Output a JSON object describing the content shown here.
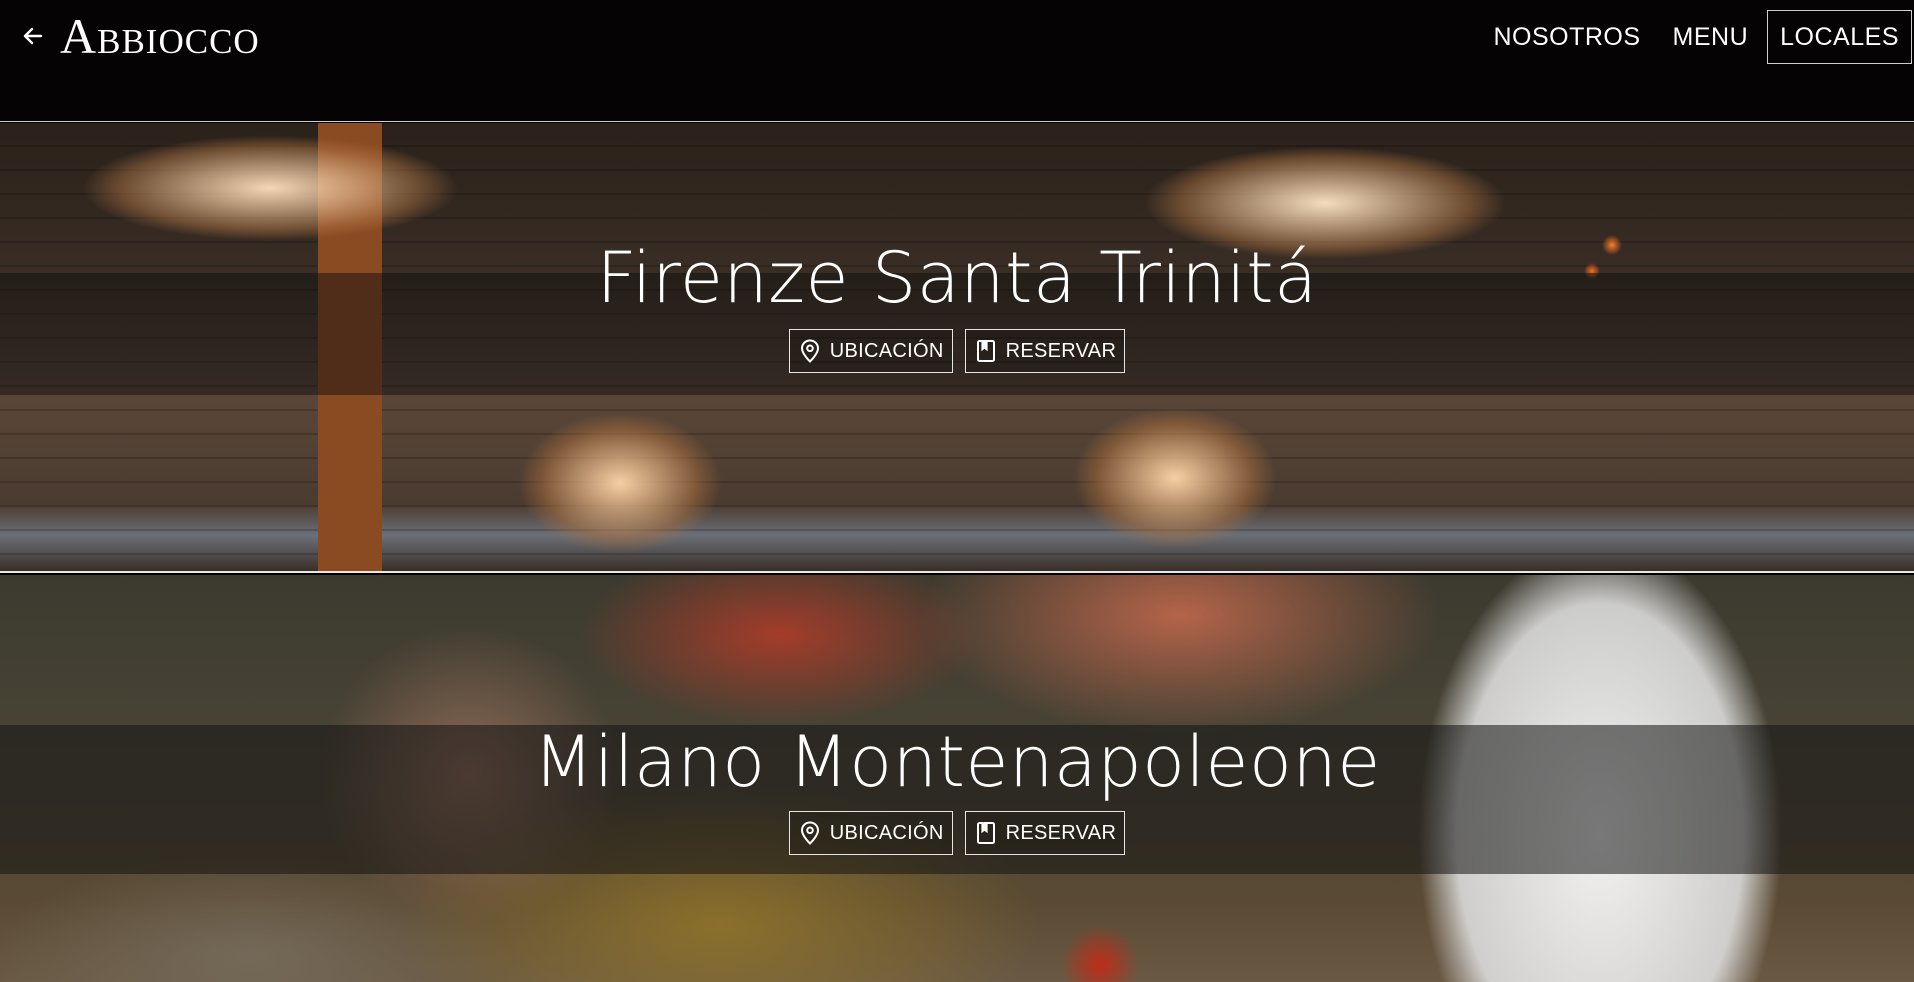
{
  "header": {
    "brand": "Abbiocco",
    "back_icon": "arrow-left-icon",
    "nav": [
      {
        "label": "NOSOTROS",
        "active": false
      },
      {
        "label": "MENU",
        "active": false
      },
      {
        "label": "LOCALES",
        "active": true
      }
    ]
  },
  "locations": [
    {
      "title": "Firenze Santa Trinitá",
      "location_button": "UBICACIÓN",
      "reserve_button": "RESERVAR",
      "location_icon": "map-pin-icon",
      "reserve_icon": "bookmark-icon"
    },
    {
      "title": "Milano Montenapoleone",
      "location_button": "UBICACIÓN",
      "reserve_button": "RESERVAR",
      "location_icon": "map-pin-icon",
      "reserve_icon": "bookmark-icon"
    }
  ],
  "colors": {
    "background": "#050304",
    "text": "#ffffff",
    "border": "#cfcfcf"
  }
}
